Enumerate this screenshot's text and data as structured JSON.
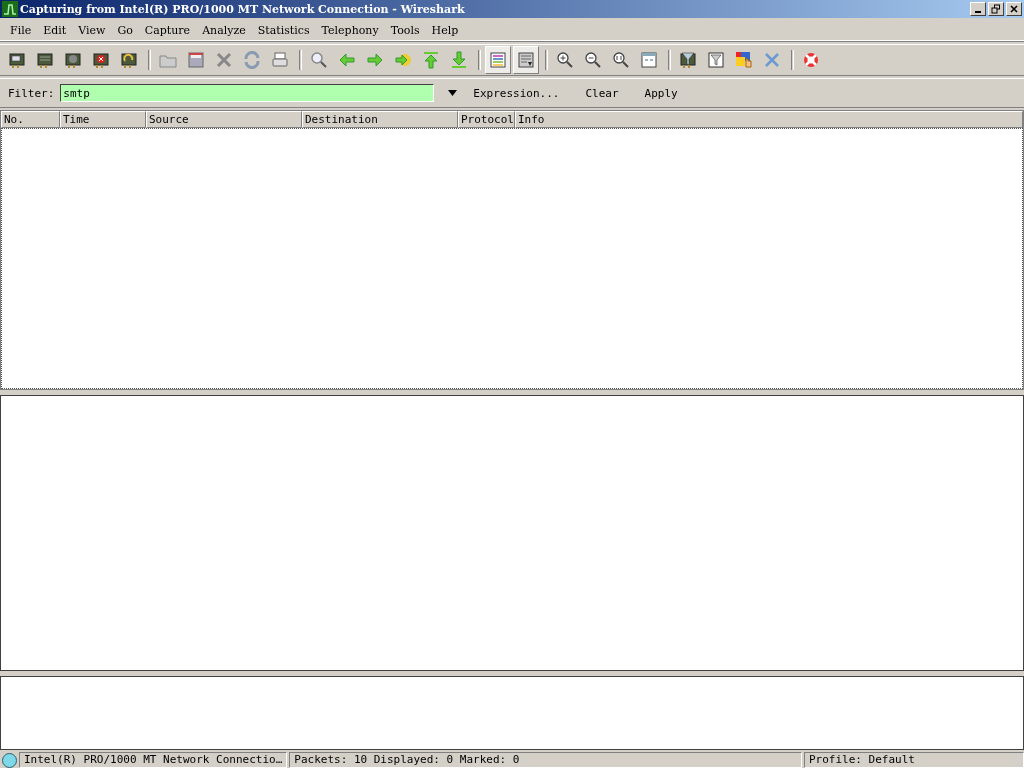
{
  "window": {
    "title": "Capturing from Intel(R) PRO/1000 MT Network Connection - Wireshark"
  },
  "menu": [
    "File",
    "Edit",
    "View",
    "Go",
    "Capture",
    "Analyze",
    "Statistics",
    "Telephony",
    "Tools",
    "Help"
  ],
  "toolbar": {
    "groups": [
      [
        {
          "pressed": false
        },
        {
          "pressed": false
        },
        {
          "pressed": false
        },
        {
          "pressed": false
        },
        {
          "pressed": false
        }
      ],
      [
        {
          "pressed": false
        },
        {
          "pressed": false
        },
        {
          "pressed": false
        },
        {
          "pressed": false
        },
        {
          "pressed": false
        }
      ],
      [
        {
          "pressed": false
        },
        {
          "pressed": false
        },
        {
          "pressed": false
        },
        {
          "pressed": false
        },
        {
          "pressed": false
        },
        {
          "pressed": false
        }
      ],
      [
        {
          "pressed": true
        },
        {
          "pressed": true
        }
      ],
      [
        {
          "pressed": false
        },
        {
          "pressed": false
        },
        {
          "pressed": false
        },
        {
          "pressed": false
        }
      ],
      [
        {
          "pressed": false
        },
        {
          "pressed": false
        },
        {
          "pressed": false
        },
        {
          "pressed": false
        }
      ],
      [
        {
          "pressed": false
        }
      ]
    ]
  },
  "filter": {
    "label": "Filter:",
    "value": "smtp",
    "valid": true,
    "buttons": [
      "Expression...",
      "Clear",
      "Apply"
    ]
  },
  "packet_list": {
    "columns": [
      "No.",
      "Time",
      "Source",
      "Destination",
      "Protocol",
      "Info"
    ]
  },
  "status_bar": {
    "interface": "Intel(R) PRO/1000 MT Network Connectio…",
    "packets": "Packets: 10 Displayed: 0 Marked: 0",
    "profile": "Profile: Default"
  }
}
